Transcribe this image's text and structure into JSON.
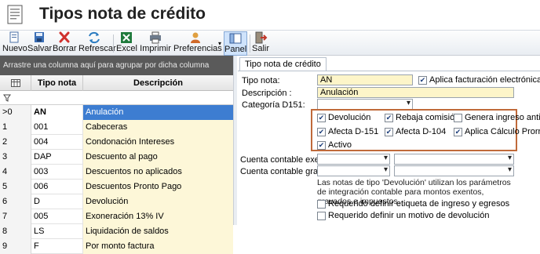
{
  "window": {
    "title": "Tipos nota de crédito"
  },
  "toolbar": {
    "nuevo": "Nuevo",
    "salvar": "Salvar",
    "borrar": "Borrar",
    "refrescar": "Refrescar",
    "excel": "Excel",
    "imprimir": "Imprimir",
    "preferencias": "Preferencias",
    "panel": "Panel",
    "salir": "Salir"
  },
  "grid": {
    "group_hint": "Arrastre una columna aquí para agrupar por dicha columna",
    "columns": {
      "tipo": "Tipo nota",
      "descripcion": "Descripción"
    },
    "rows": [
      {
        "index": "0",
        "tipo": "AN",
        "desc": "Anulación"
      },
      {
        "index": "1",
        "tipo": "001",
        "desc": "Cabeceras"
      },
      {
        "index": "2",
        "tipo": "004",
        "desc": "Condonación Intereses"
      },
      {
        "index": "3",
        "tipo": "DAP",
        "desc": "Descuento al pago"
      },
      {
        "index": "4",
        "tipo": "003",
        "desc": "Descuentos no aplicados"
      },
      {
        "index": "5",
        "tipo": "006",
        "desc": "Descuentos Pronto Pago"
      },
      {
        "index": "6",
        "tipo": "D",
        "desc": "Devolución"
      },
      {
        "index": "7",
        "tipo": "005",
        "desc": "Exoneración 13% IV"
      },
      {
        "index": "8",
        "tipo": "LS",
        "desc": "Liquidación de saldos"
      },
      {
        "index": "9",
        "tipo": "F",
        "desc": "Por monto factura"
      }
    ],
    "selected_marker": ">"
  },
  "detail": {
    "tab": "Tipo nota de crédito",
    "tipo_label": "Tipo nota:",
    "tipo_value": "AN",
    "fe_label": "Aplica facturación electrónica",
    "desc_label": "Descripción :",
    "desc_value": "Anulación",
    "categoria_label": "Categoría D151:",
    "checks": {
      "devolucion": "Devolución",
      "rebaja": "Rebaja comisión",
      "genera": "Genera ingreso anticipado",
      "afecta151": "Afecta D-151",
      "afecta104": "Afecta D-104",
      "prorrata": "Aplica Cálculo Prorrata",
      "activo": "Activo"
    },
    "exento_label": "Cuenta contable exento:",
    "gravado_label": "Cuenta contable gravado:",
    "note": "Las notas de tipo 'Devolución' utilizan los parámetros de integración contable para montos exentos, gravados e impuestos.",
    "req_etiqueta": "Requerido definir etiqueta de ingreso y egresos",
    "req_motivo": "Requerido definir un motivo de devolución"
  }
}
